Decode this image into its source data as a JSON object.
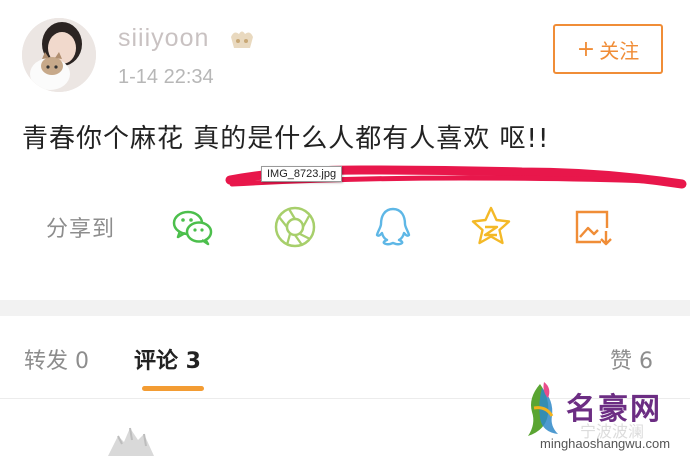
{
  "post": {
    "username": "siiiyoon",
    "time": "1-14 22:34",
    "follow_plus": "+",
    "follow_label": "关注",
    "text": "青春你个麻花 真的是什么人都有人喜欢 呕!!",
    "image_tooltip": "IMG_8723.jpg"
  },
  "share": {
    "label": "分享到",
    "icons": [
      "wechat-icon",
      "moments-icon",
      "qq-icon",
      "qzone-icon",
      "save-image-icon"
    ]
  },
  "tabs": {
    "repost": "转发 0",
    "comment": "评论 3",
    "like": "赞 6"
  },
  "watermark": {
    "title": "名豪网",
    "url": "minghaoshangwu.com",
    "faint": "宁波波澜"
  },
  "colors": {
    "accent": "#f08d37",
    "wechat": "#4cbf4c",
    "moments": "#a7cf6b",
    "qq": "#5eb7e6",
    "qzone": "#f4b927",
    "save": "#f08d37",
    "scribble": "#e8174b"
  }
}
